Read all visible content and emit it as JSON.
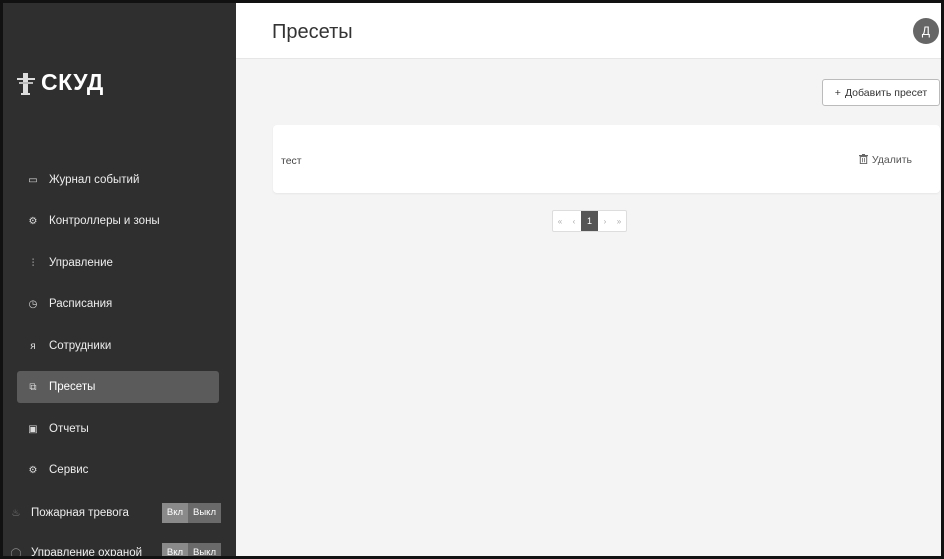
{
  "header": {
    "title": "Пресеты",
    "avatar_letter": "Д"
  },
  "logo": {
    "text": "СКУД",
    "icon": "turnstile-icon"
  },
  "sidebar": {
    "items": [
      {
        "label": "Журнал событий",
        "icon": "monitor-icon",
        "glyph": "▭"
      },
      {
        "label": "Контроллеры и зоны",
        "icon": "chip-icon",
        "glyph": "⚙"
      },
      {
        "label": "Управление",
        "icon": "sliders-icon",
        "glyph": "⫶"
      },
      {
        "label": "Расписания",
        "icon": "clock-icon",
        "glyph": "◷"
      },
      {
        "label": "Сотрудники",
        "icon": "users-icon",
        "glyph": "ᴙ"
      },
      {
        "label": "Пресеты",
        "icon": "presets-icon",
        "glyph": "⧉",
        "active": true
      },
      {
        "label": "Отчеты",
        "icon": "report-icon",
        "glyph": "▣"
      },
      {
        "label": "Сервис",
        "icon": "service-icon",
        "glyph": "⚙"
      }
    ],
    "toggles": [
      {
        "label": "Пожарная тревога",
        "icon": "fire-icon",
        "glyph": "♨",
        "on": "Вкл",
        "off": "Выкл"
      },
      {
        "label": "Управление охраной",
        "icon": "shield-icon",
        "glyph": "◯",
        "on": "Вкл",
        "off": "Выкл"
      }
    ]
  },
  "main": {
    "add_button": {
      "icon": "+",
      "label": "Добавить пресет"
    },
    "presets": [
      {
        "name": "тест",
        "delete_label": "Удалить"
      }
    ],
    "pagination": {
      "first": "«",
      "prev": "‹",
      "current": "1",
      "next": "›",
      "last": "»"
    }
  },
  "colors": {
    "sidebar_bg": "#2f2f2f",
    "active_item": "#5b5b5b",
    "page_bg": "#f4f4f4"
  }
}
